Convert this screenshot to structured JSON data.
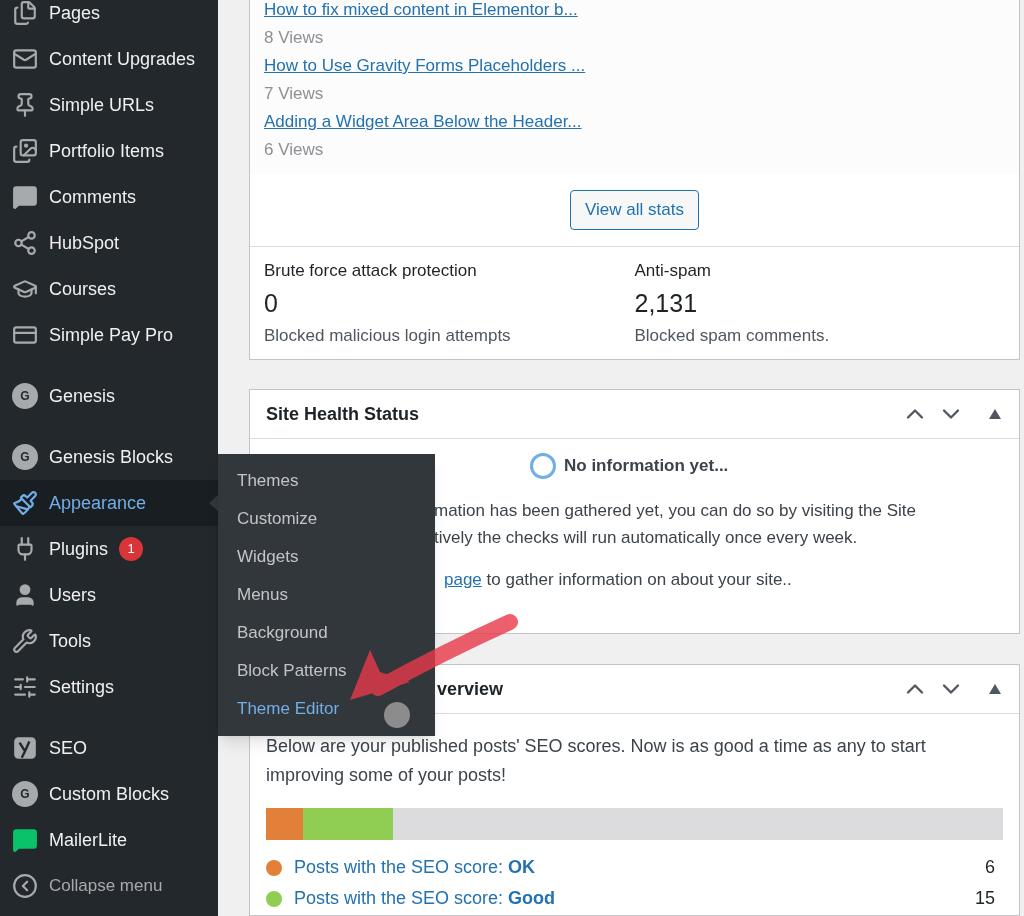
{
  "sidebar": {
    "groups": [
      {
        "items": [
          {
            "label": "Pages",
            "selected": false
          },
          {
            "label": "Content Upgrades",
            "selected": false
          },
          {
            "label": "Simple URLs",
            "selected": false
          },
          {
            "label": "Portfolio Items",
            "selected": false
          },
          {
            "label": "Comments",
            "selected": false
          },
          {
            "label": "HubSpot",
            "selected": false
          },
          {
            "label": "Courses",
            "selected": false
          },
          {
            "label": "Simple Pay Pro",
            "selected": false
          }
        ]
      },
      {
        "items": [
          {
            "label": "Genesis",
            "selected": false,
            "icon_letter": "G"
          }
        ]
      },
      {
        "items": [
          {
            "label": "Genesis Blocks",
            "selected": false,
            "icon_letter": "G"
          },
          {
            "label": "Appearance",
            "selected": true
          },
          {
            "label": "Plugins",
            "selected": false,
            "badge": "1"
          },
          {
            "label": "Users",
            "selected": false
          },
          {
            "label": "Tools",
            "selected": false
          },
          {
            "label": "Settings",
            "selected": false
          }
        ]
      },
      {
        "items": [
          {
            "label": "SEO",
            "selected": false
          },
          {
            "label": "Custom Blocks",
            "selected": false,
            "icon_letter": "G"
          },
          {
            "label": "MailerLite",
            "selected": false
          },
          {
            "label": "Collapse menu",
            "selected": false
          }
        ]
      }
    ],
    "flyout": [
      {
        "label": "Themes",
        "selected": false
      },
      {
        "label": "Customize",
        "selected": false
      },
      {
        "label": "Widgets",
        "selected": false
      },
      {
        "label": "Menus",
        "selected": false
      },
      {
        "label": "Background",
        "selected": false
      },
      {
        "label": "Block Patterns",
        "selected": false
      },
      {
        "label": "Theme Editor",
        "selected": true
      }
    ]
  },
  "stats_card": {
    "posts": [
      {
        "title": "How to fix mixed content in Elementor b...",
        "views": "8 Views"
      },
      {
        "title": "How to Use Gravity Forms Placeholders ...",
        "views": "7 Views"
      },
      {
        "title": "Adding a Widget Area Below the Header...",
        "views": "6 Views"
      }
    ],
    "button": "View all stats",
    "stats": [
      {
        "label": "Brute force attack protection",
        "value": "0",
        "description": "Blocked malicious login attempts"
      },
      {
        "label": "Anti-spam",
        "value": "2,131",
        "description": "Blocked spam comments."
      }
    ]
  },
  "site_health": {
    "title": "Site Health Status",
    "status": "No information yet...",
    "lines": [
      "mation has been gathered yet, you can do so by visiting the Site",
      "tively the checks will run automatically once every week."
    ],
    "link": "page",
    "after_link": " to gather information on about your site.."
  },
  "seo_overview": {
    "title": "verview",
    "intro": "Below are your published posts' SEO scores. Now is as good a time as any to start improving some of your posts!",
    "segments": [
      {
        "color": "#e2803a",
        "level": 0.05
      },
      {
        "color": "#8fcd53",
        "level": 0.123
      }
    ],
    "legend": [
      {
        "color": "#e2803a",
        "label": "Posts with the SEO score: **OK**",
        "count": "6"
      },
      {
        "color": "#8fcd53",
        "label": "Posts with the SEO score: **Good**",
        "count": "15"
      }
    ]
  }
}
